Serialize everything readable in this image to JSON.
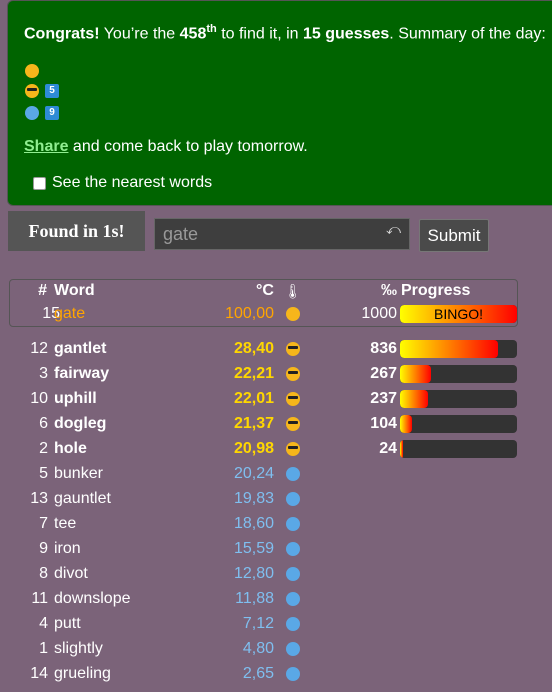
{
  "summary": {
    "congrats_bold": "Congrats!",
    "text_1": "You’re the",
    "rank": "458",
    "rank_suffix": "th",
    "text_2": "to find it, in",
    "guesses": "15 guesses",
    "text_3": ". Summary of the day:",
    "rows": [
      {
        "emoji": "hot-emoji",
        "count": ""
      },
      {
        "emoji": "sunglasses-emoji",
        "count": "5"
      },
      {
        "emoji": "cold-emoji",
        "count": "9"
      }
    ],
    "share_link": "Share",
    "share_text": "and come back to play tomorrow.",
    "nearest_label": "See the nearest words"
  },
  "found": "Found in 1s!",
  "input": {
    "value": "gate",
    "undo_icon": "⤺"
  },
  "submit": "Submit",
  "headers": {
    "num": "#",
    "word": "Word",
    "temp": "°C",
    "thermometer_icon": "🌡",
    "permille": "‰",
    "progress": "Progress"
  },
  "latest": {
    "num": "15",
    "word": "gate",
    "temp": "100,00",
    "emoji": "hot-emoji",
    "permille": "1000",
    "progress": 1000,
    "bingo": "BINGO!"
  },
  "guesses": [
    {
      "num": "12",
      "word": "gantlet",
      "temp": "28,40",
      "emoji": "sunglasses-emoji",
      "permille": "836",
      "progress": 836
    },
    {
      "num": "3",
      "word": "fairway",
      "temp": "22,21",
      "emoji": "sunglasses-emoji",
      "permille": "267",
      "progress": 267
    },
    {
      "num": "10",
      "word": "uphill",
      "temp": "22,01",
      "emoji": "sunglasses-emoji",
      "permille": "237",
      "progress": 237
    },
    {
      "num": "6",
      "word": "dogleg",
      "temp": "21,37",
      "emoji": "sunglasses-emoji",
      "permille": "104",
      "progress": 104
    },
    {
      "num": "2",
      "word": "hole",
      "temp": "20,98",
      "emoji": "sunglasses-emoji",
      "permille": "24",
      "progress": 24
    },
    {
      "num": "5",
      "word": "bunker",
      "temp": "20,24",
      "emoji": "cold-emoji"
    },
    {
      "num": "13",
      "word": "gauntlet",
      "temp": "19,83",
      "emoji": "cold-emoji"
    },
    {
      "num": "7",
      "word": "tee",
      "temp": "18,60",
      "emoji": "cold-emoji"
    },
    {
      "num": "9",
      "word": "iron",
      "temp": "15,59",
      "emoji": "cold-emoji"
    },
    {
      "num": "8",
      "word": "divot",
      "temp": "12,80",
      "emoji": "cold-emoji"
    },
    {
      "num": "11",
      "word": "downslope",
      "temp": "11,88",
      "emoji": "cold-emoji"
    },
    {
      "num": "4",
      "word": "putt",
      "temp": "7,12",
      "emoji": "cold-emoji"
    },
    {
      "num": "1",
      "word": "slightly",
      "temp": "4,80",
      "emoji": "cold-emoji"
    },
    {
      "num": "14",
      "word": "grueling",
      "temp": "2,65",
      "emoji": "cold-emoji"
    }
  ],
  "colors": {
    "success_bg": "#006400",
    "page_bg": "#7b6379",
    "gold": "#ffd700",
    "orange": "#ffa500",
    "blue": "#7fbff0",
    "link": "#90ee90"
  }
}
